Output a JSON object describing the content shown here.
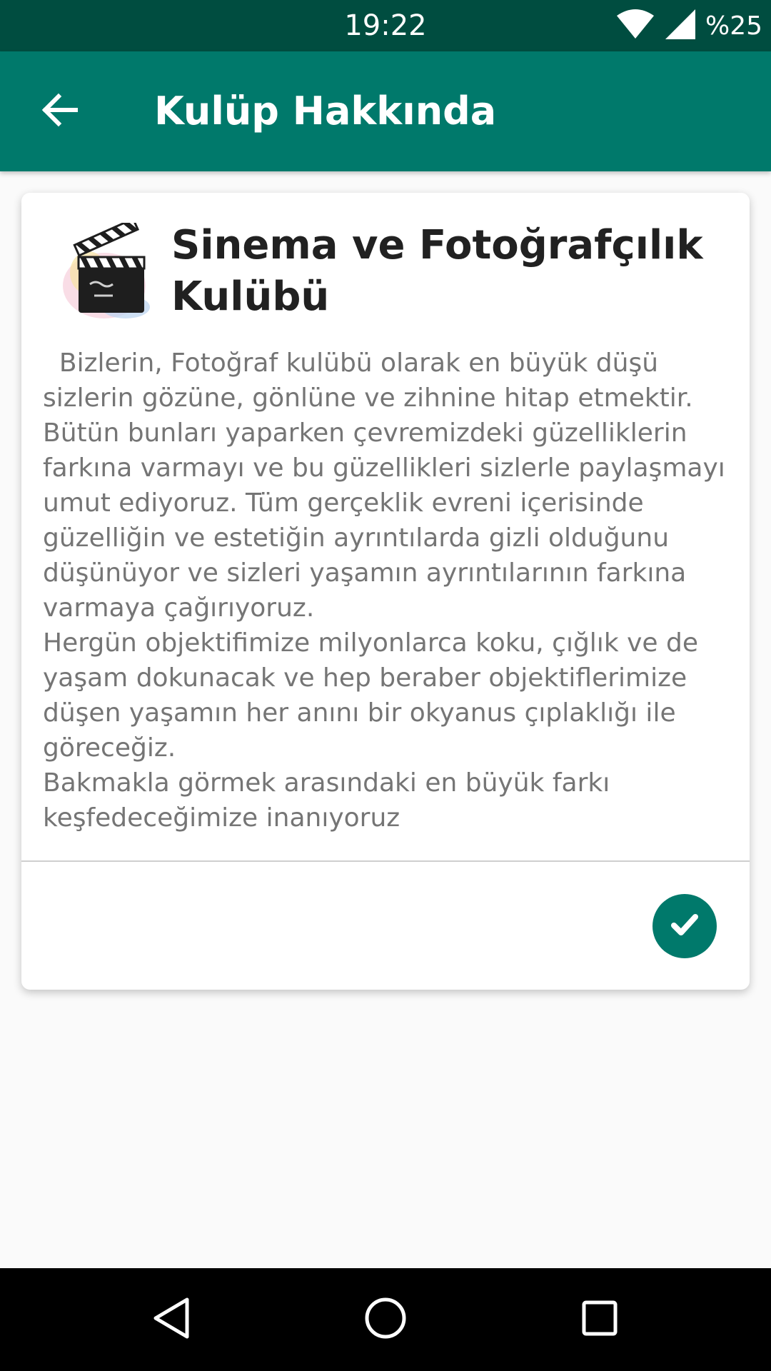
{
  "status_bar": {
    "time": "19:22",
    "battery_text": "%25",
    "icons": [
      "wifi-icon",
      "signal-icon"
    ]
  },
  "app_bar": {
    "title": "Kulüp Hakkında",
    "back_icon": "arrow-back-icon",
    "color": "#00796b",
    "status_color": "#004d40"
  },
  "club": {
    "name": "Sinema ve Fotoğrafçılık Kulübü",
    "logo_icon": "clapperboard-icon",
    "description": "  Bizlerin, Fotoğraf kulübü olarak en büyük düşü sizlerin gözüne, gönlüne ve zihnine hitap etmektir. Bütün bunları yaparken çevremizdeki güzelliklerin farkına varmayı ve bu güzellikleri sizlerle paylaşmayı umut ediyoruz. Tüm gerçeklik evreni içerisinde güzelliğin ve estetiğin ayrıntılarda gizli olduğunu düşünüyor ve sizleri yaşamın ayrıntılarının farkına varmaya çağırıyoruz.\nHergün objektifimize milyonlarca koku, çığlık ve de yaşam dokunacak ve hep beraber objektiflerimize düşen yaşamın her anını bir okyanus çıplaklığı ile göreceğiz.\nBakmakla görmek arasındaki en büyük farkı keşfedeceğimize inanıyoruz"
  },
  "actions": {
    "confirm_icon": "check-icon"
  },
  "nav_bar": {
    "buttons": [
      "back-triangle-icon",
      "home-circle-icon",
      "recents-square-icon"
    ]
  }
}
